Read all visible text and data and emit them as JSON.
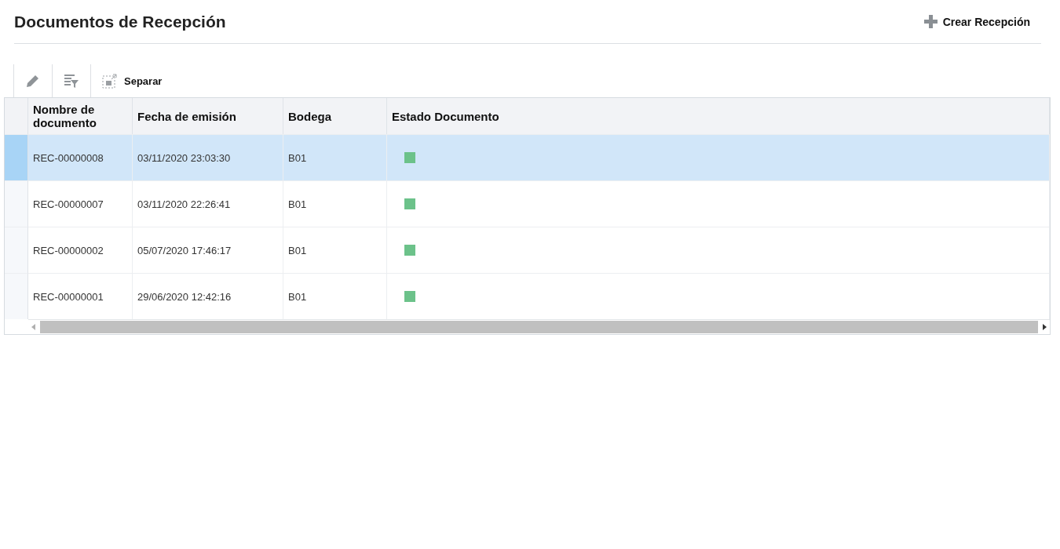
{
  "header": {
    "title": "Documentos de Recepción",
    "create_button": "Crear Recepción"
  },
  "toolbar": {
    "split_button": "Separar"
  },
  "table": {
    "columns": [
      "Nombre de documento",
      "Fecha de emisión",
      "Bodega",
      "Estado Documento"
    ],
    "rows": [
      {
        "name": "REC-00000008",
        "date": "03/11/2020 23:03:30",
        "warehouse": "B01",
        "color": "#6cc28a",
        "selected": true
      },
      {
        "name": "REC-00000007",
        "date": "03/11/2020 22:26:41",
        "warehouse": "B01",
        "color": "#6cc28a",
        "selected": false
      },
      {
        "name": "REC-00000002",
        "date": "05/07/2020 17:46:17",
        "warehouse": "B01",
        "color": "#6cc28a",
        "selected": false
      },
      {
        "name": "REC-00000001",
        "date": "29/06/2020 12:42:16",
        "warehouse": "B01",
        "color": "#6cc28a",
        "selected": false
      }
    ]
  }
}
